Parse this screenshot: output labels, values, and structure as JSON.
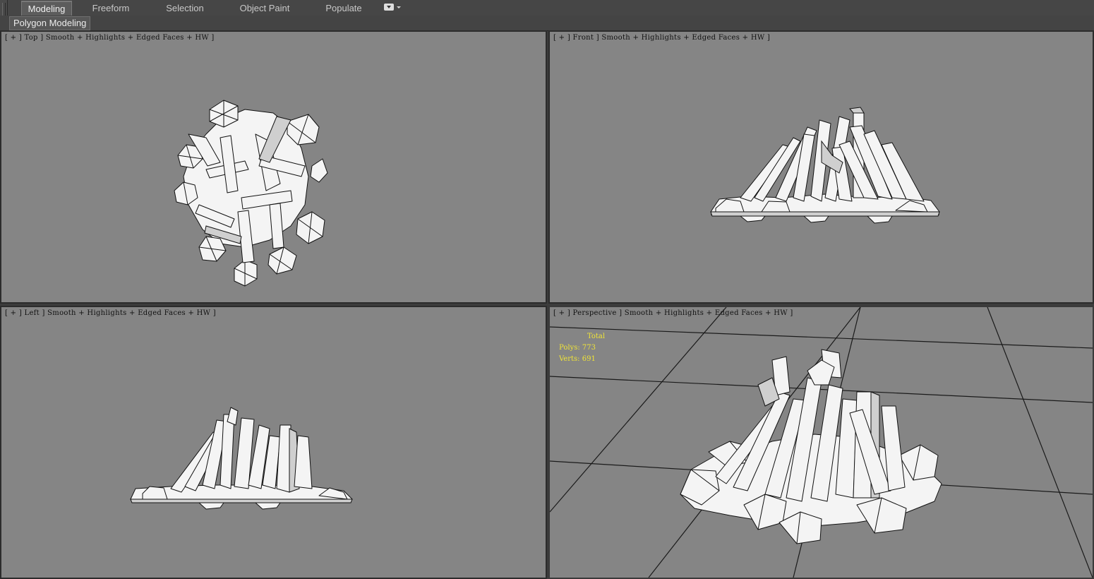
{
  "ribbon": {
    "tabs": [
      {
        "label": "Modeling",
        "active": true
      },
      {
        "label": "Freeform",
        "active": false
      },
      {
        "label": "Selection",
        "active": false
      },
      {
        "label": "Object Paint",
        "active": false
      },
      {
        "label": "Populate",
        "active": false
      }
    ],
    "panel_label": "Polygon Modeling"
  },
  "viewports": {
    "top": {
      "label": "[ + ] Top ] Smooth + Highlights + Edged Faces + HW ]"
    },
    "front": {
      "label": "[ + ] Front ] Smooth + Highlights + Edged Faces + HW ]"
    },
    "left": {
      "label": "[ + ] Left ] Smooth + Highlights + Edged Faces + HW ]"
    },
    "perspective": {
      "label": "[ + ] Perspective ] Smooth + Highlights + Edged Faces + HW ]"
    }
  },
  "stats": {
    "title": "Total",
    "polys_label": "Polys:",
    "polys_value": "773",
    "verts_label": "Verts:",
    "verts_value": "691"
  },
  "colors": {
    "viewport_bg": "#858585",
    "stats_text": "#f0e437",
    "mesh_fill": "#f4f4f4",
    "wire": "#111111"
  }
}
